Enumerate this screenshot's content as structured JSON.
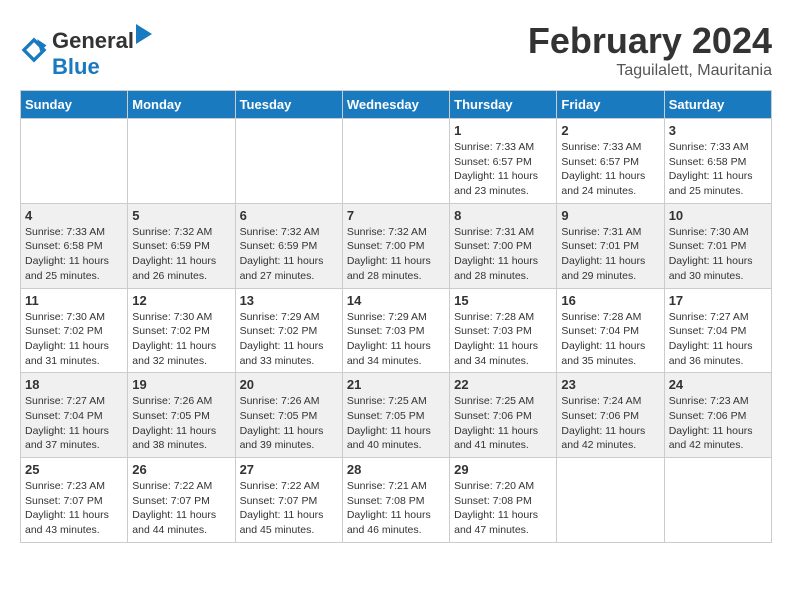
{
  "logo": {
    "text_general": "General",
    "text_blue": "Blue"
  },
  "title": {
    "month_year": "February 2024",
    "location": "Taguilalett, Mauritania"
  },
  "weekdays": [
    "Sunday",
    "Monday",
    "Tuesday",
    "Wednesday",
    "Thursday",
    "Friday",
    "Saturday"
  ],
  "weeks": [
    [
      {
        "day": "",
        "info": ""
      },
      {
        "day": "",
        "info": ""
      },
      {
        "day": "",
        "info": ""
      },
      {
        "day": "",
        "info": ""
      },
      {
        "day": "1",
        "info": "Sunrise: 7:33 AM\nSunset: 6:57 PM\nDaylight: 11 hours and 23 minutes."
      },
      {
        "day": "2",
        "info": "Sunrise: 7:33 AM\nSunset: 6:57 PM\nDaylight: 11 hours and 24 minutes."
      },
      {
        "day": "3",
        "info": "Sunrise: 7:33 AM\nSunset: 6:58 PM\nDaylight: 11 hours and 25 minutes."
      }
    ],
    [
      {
        "day": "4",
        "info": "Sunrise: 7:33 AM\nSunset: 6:58 PM\nDaylight: 11 hours and 25 minutes."
      },
      {
        "day": "5",
        "info": "Sunrise: 7:32 AM\nSunset: 6:59 PM\nDaylight: 11 hours and 26 minutes."
      },
      {
        "day": "6",
        "info": "Sunrise: 7:32 AM\nSunset: 6:59 PM\nDaylight: 11 hours and 27 minutes."
      },
      {
        "day": "7",
        "info": "Sunrise: 7:32 AM\nSunset: 7:00 PM\nDaylight: 11 hours and 28 minutes."
      },
      {
        "day": "8",
        "info": "Sunrise: 7:31 AM\nSunset: 7:00 PM\nDaylight: 11 hours and 28 minutes."
      },
      {
        "day": "9",
        "info": "Sunrise: 7:31 AM\nSunset: 7:01 PM\nDaylight: 11 hours and 29 minutes."
      },
      {
        "day": "10",
        "info": "Sunrise: 7:30 AM\nSunset: 7:01 PM\nDaylight: 11 hours and 30 minutes."
      }
    ],
    [
      {
        "day": "11",
        "info": "Sunrise: 7:30 AM\nSunset: 7:02 PM\nDaylight: 11 hours and 31 minutes."
      },
      {
        "day": "12",
        "info": "Sunrise: 7:30 AM\nSunset: 7:02 PM\nDaylight: 11 hours and 32 minutes."
      },
      {
        "day": "13",
        "info": "Sunrise: 7:29 AM\nSunset: 7:02 PM\nDaylight: 11 hours and 33 minutes."
      },
      {
        "day": "14",
        "info": "Sunrise: 7:29 AM\nSunset: 7:03 PM\nDaylight: 11 hours and 34 minutes."
      },
      {
        "day": "15",
        "info": "Sunrise: 7:28 AM\nSunset: 7:03 PM\nDaylight: 11 hours and 34 minutes."
      },
      {
        "day": "16",
        "info": "Sunrise: 7:28 AM\nSunset: 7:04 PM\nDaylight: 11 hours and 35 minutes."
      },
      {
        "day": "17",
        "info": "Sunrise: 7:27 AM\nSunset: 7:04 PM\nDaylight: 11 hours and 36 minutes."
      }
    ],
    [
      {
        "day": "18",
        "info": "Sunrise: 7:27 AM\nSunset: 7:04 PM\nDaylight: 11 hours and 37 minutes."
      },
      {
        "day": "19",
        "info": "Sunrise: 7:26 AM\nSunset: 7:05 PM\nDaylight: 11 hours and 38 minutes."
      },
      {
        "day": "20",
        "info": "Sunrise: 7:26 AM\nSunset: 7:05 PM\nDaylight: 11 hours and 39 minutes."
      },
      {
        "day": "21",
        "info": "Sunrise: 7:25 AM\nSunset: 7:05 PM\nDaylight: 11 hours and 40 minutes."
      },
      {
        "day": "22",
        "info": "Sunrise: 7:25 AM\nSunset: 7:06 PM\nDaylight: 11 hours and 41 minutes."
      },
      {
        "day": "23",
        "info": "Sunrise: 7:24 AM\nSunset: 7:06 PM\nDaylight: 11 hours and 42 minutes."
      },
      {
        "day": "24",
        "info": "Sunrise: 7:23 AM\nSunset: 7:06 PM\nDaylight: 11 hours and 42 minutes."
      }
    ],
    [
      {
        "day": "25",
        "info": "Sunrise: 7:23 AM\nSunset: 7:07 PM\nDaylight: 11 hours and 43 minutes."
      },
      {
        "day": "26",
        "info": "Sunrise: 7:22 AM\nSunset: 7:07 PM\nDaylight: 11 hours and 44 minutes."
      },
      {
        "day": "27",
        "info": "Sunrise: 7:22 AM\nSunset: 7:07 PM\nDaylight: 11 hours and 45 minutes."
      },
      {
        "day": "28",
        "info": "Sunrise: 7:21 AM\nSunset: 7:08 PM\nDaylight: 11 hours and 46 minutes."
      },
      {
        "day": "29",
        "info": "Sunrise: 7:20 AM\nSunset: 7:08 PM\nDaylight: 11 hours and 47 minutes."
      },
      {
        "day": "",
        "info": ""
      },
      {
        "day": "",
        "info": ""
      }
    ]
  ]
}
